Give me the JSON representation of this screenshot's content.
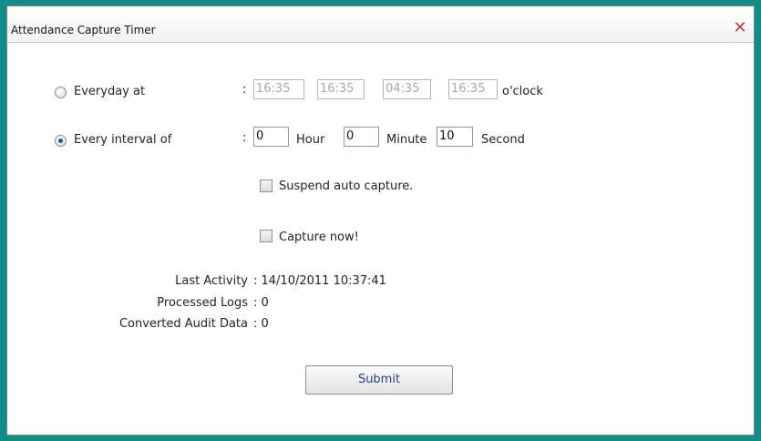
{
  "window": {
    "title": "Attendance Capture Timer",
    "close_glyph": "✕"
  },
  "schedule": {
    "everyday": {
      "label": "Everyday at",
      "selected": false,
      "colon": ":",
      "times": [
        "16:35",
        "16:35",
        "04:35",
        "16:35"
      ],
      "suffix": "o'clock"
    },
    "interval": {
      "label": "Every interval of",
      "selected": true,
      "colon": ":",
      "hour_value": "0",
      "hour_label": "Hour",
      "minute_value": "0",
      "minute_label": "Minute",
      "second_value": "10",
      "second_label": "Second"
    }
  },
  "options": {
    "suspend_label": "Suspend auto capture.",
    "suspend_checked": false,
    "capture_now_label": "Capture now!",
    "capture_now_checked": false
  },
  "stats": {
    "last_activity_label": "Last Activity",
    "last_activity_value": ": 14/10/2011 10:37:41",
    "processed_logs_label": "Processed Logs",
    "processed_logs_value": ": 0",
    "converted_audit_label": "Converted Audit Data",
    "converted_audit_value": ": 0"
  },
  "actions": {
    "submit_label": "Submit"
  },
  "colors": {
    "frame": "#138b87",
    "close": "#d03838",
    "button_text": "#2b3b8f"
  }
}
